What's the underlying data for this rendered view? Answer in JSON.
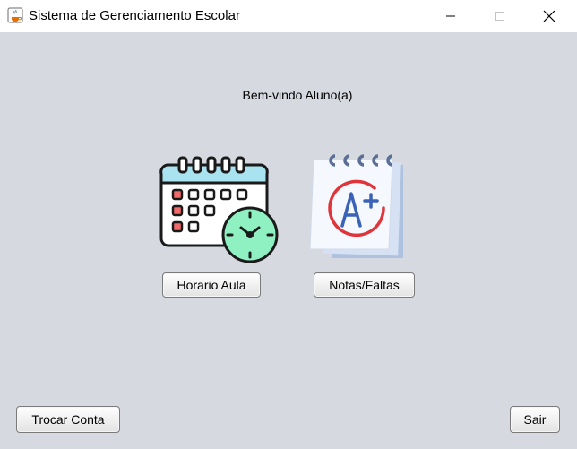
{
  "window": {
    "title": "Sistema de Gerenciamento Escolar"
  },
  "icons": {
    "app": "java-icon",
    "minimize": "minimize-icon",
    "maximize": "maximize-icon",
    "close": "close-icon"
  },
  "main": {
    "welcome": "Bem-vindo Aluno(a)",
    "calendar_icon": "calendar-clock-icon",
    "notes_icon": "grades-notepad-icon",
    "horario_button": "Horario Aula",
    "notas_button": "Notas/Faltas"
  },
  "footer": {
    "trocar_button": "Trocar Conta",
    "sair_button": "Sair"
  },
  "colors": {
    "background": "#d6d9e0",
    "titlebar": "#ffffff"
  }
}
